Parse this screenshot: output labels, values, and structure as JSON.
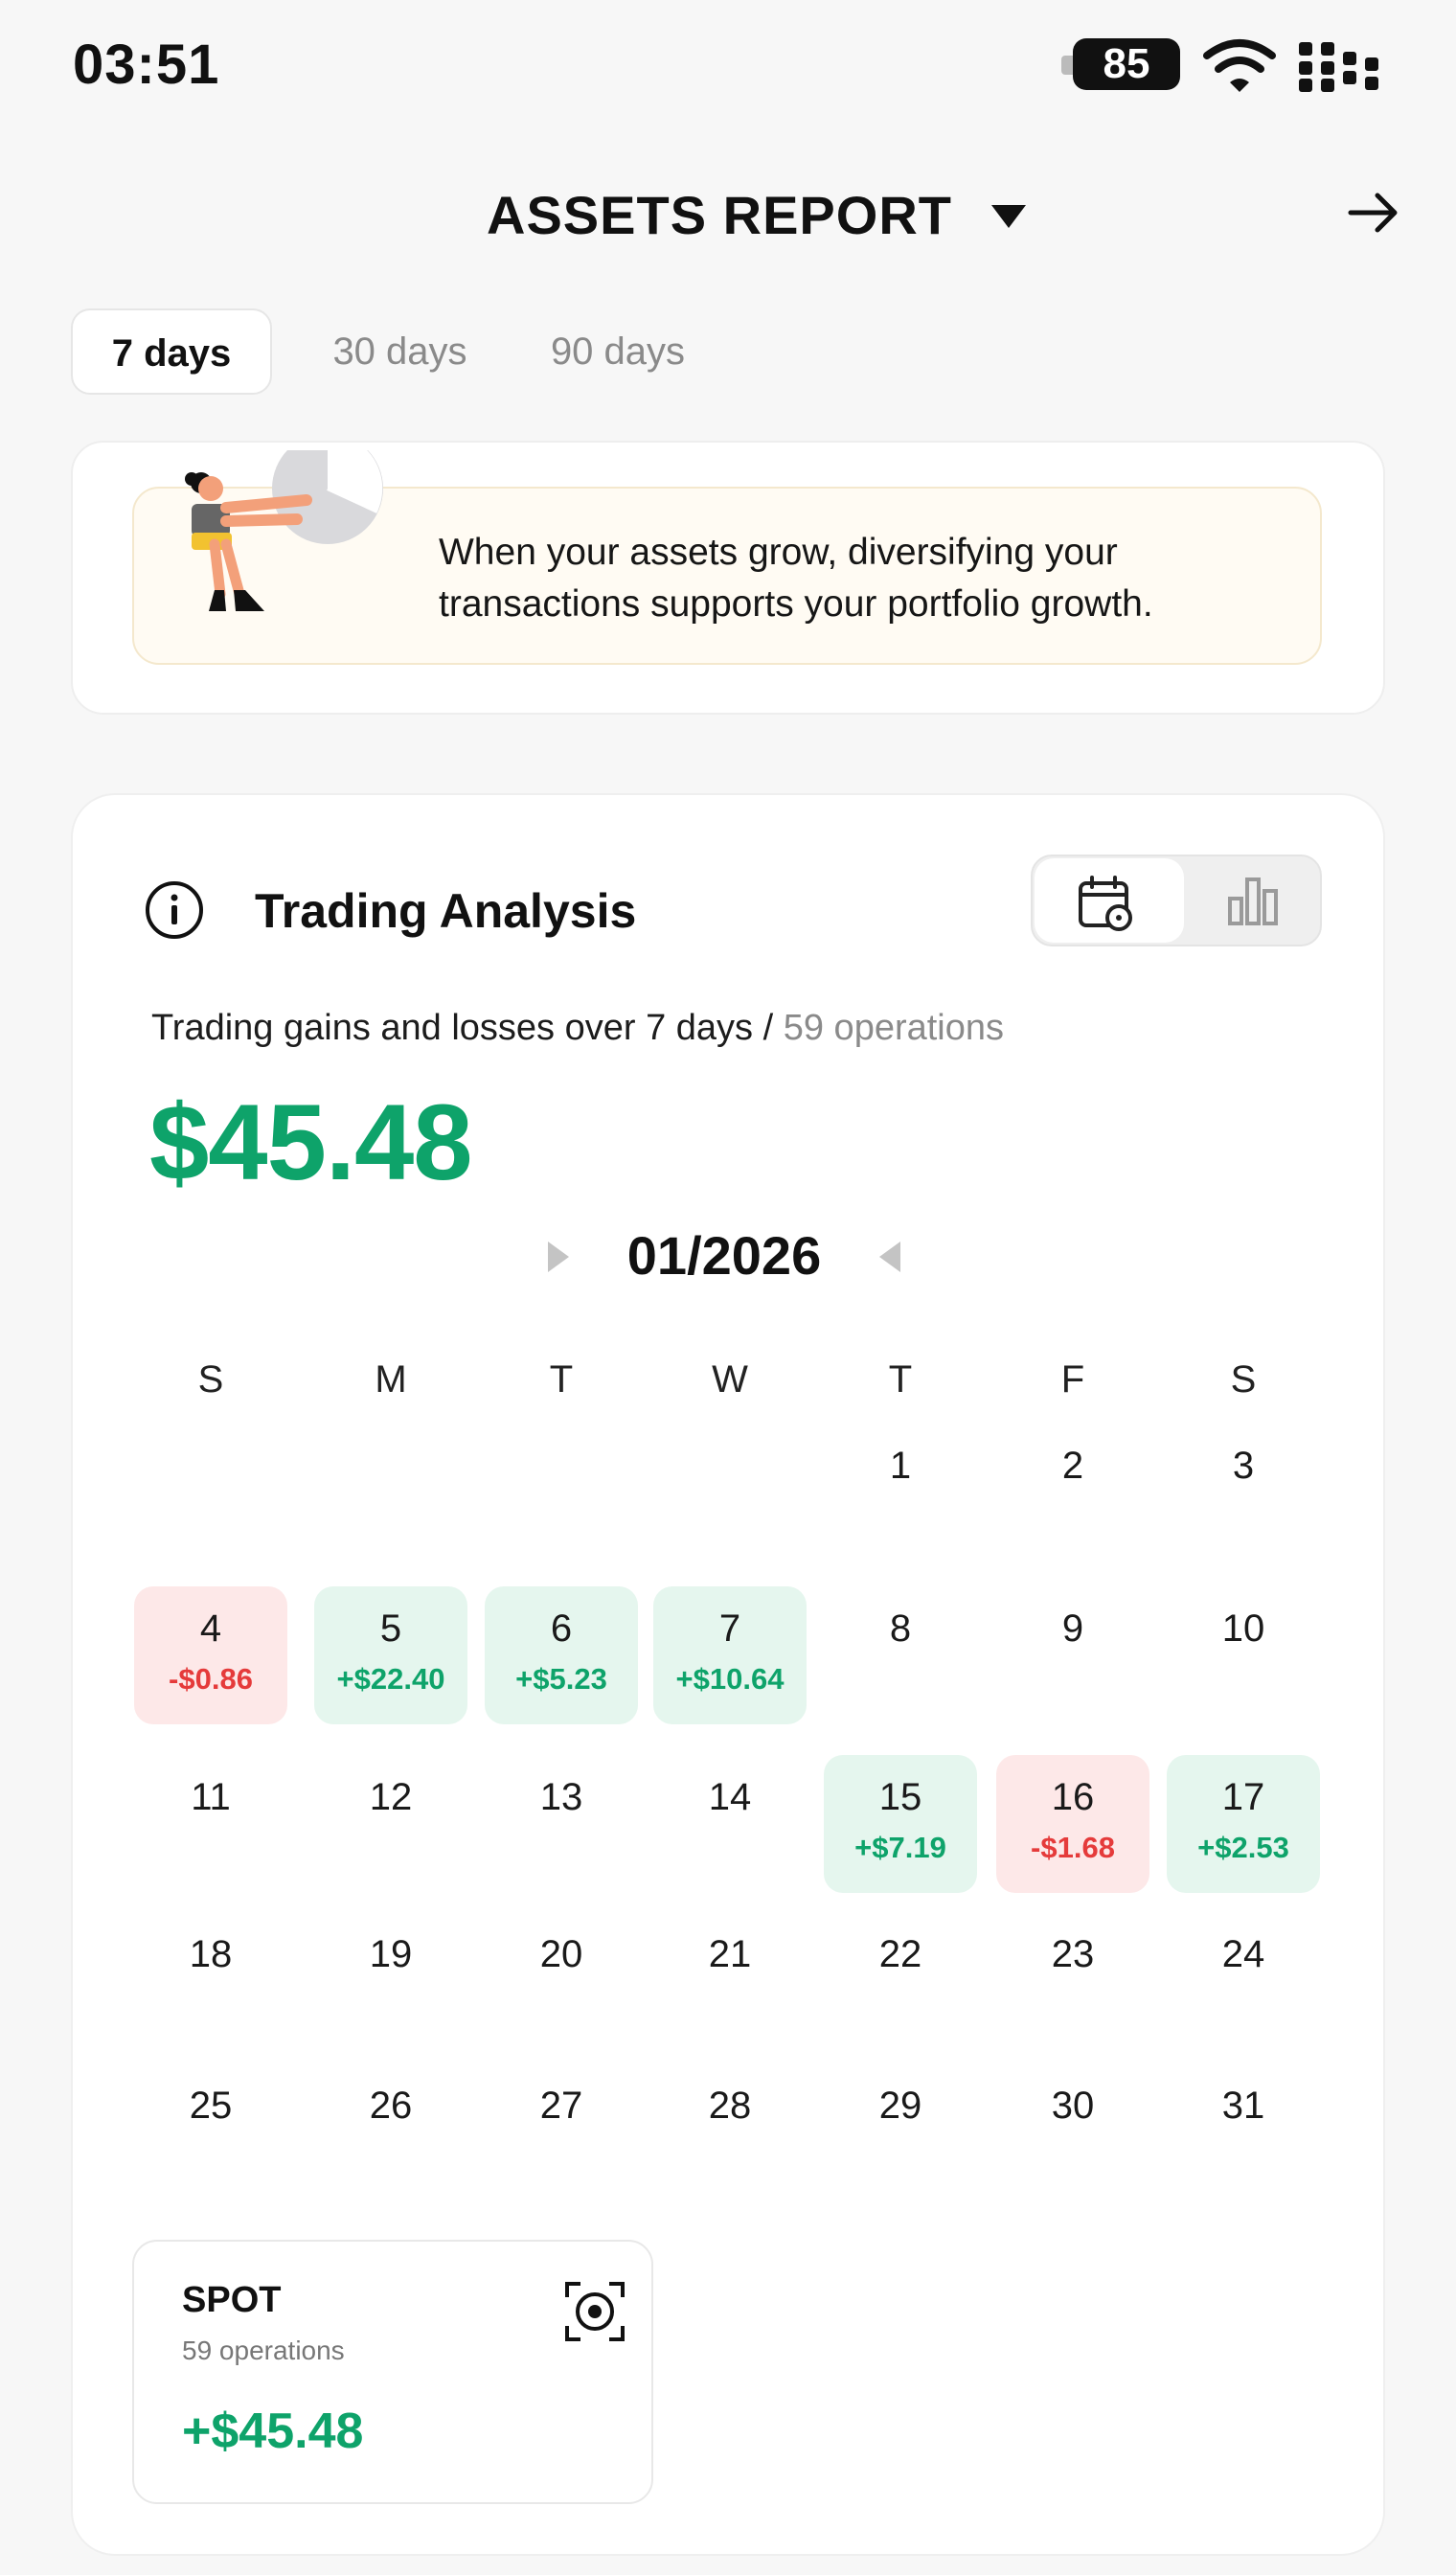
{
  "status_bar": {
    "time": "03:51",
    "battery": "85"
  },
  "header": {
    "title": "ASSETS REPORT"
  },
  "tabs": [
    {
      "label": "7 days",
      "active": true
    },
    {
      "label": "30 days",
      "active": false
    },
    {
      "label": "90 days",
      "active": false
    }
  ],
  "banner": {
    "text": "When your assets grow, diversifying your transactions supports your portfolio growth."
  },
  "trading": {
    "title": "Trading Analysis",
    "subtitle": "Trading gains and losses over 7 days / ",
    "operations": "59 operations",
    "total": "$45.48",
    "month": "01/2026",
    "weekdays": [
      "S",
      "M",
      "T",
      "W",
      "T",
      "F",
      "S"
    ],
    "colors": {
      "gain": "#0ea36a",
      "loss": "#e53b3b"
    },
    "days": [
      {
        "day": "1",
        "pnl": ""
      },
      {
        "day": "2",
        "pnl": ""
      },
      {
        "day": "3",
        "pnl": ""
      },
      {
        "day": "4",
        "pnl": "-$0.86"
      },
      {
        "day": "5",
        "pnl": "+$22.40"
      },
      {
        "day": "6",
        "pnl": "+$5.23"
      },
      {
        "day": "7",
        "pnl": "+$10.64"
      },
      {
        "day": "8",
        "pnl": ""
      },
      {
        "day": "9",
        "pnl": ""
      },
      {
        "day": "10",
        "pnl": ""
      },
      {
        "day": "11",
        "pnl": ""
      },
      {
        "day": "12",
        "pnl": ""
      },
      {
        "day": "13",
        "pnl": ""
      },
      {
        "day": "14",
        "pnl": ""
      },
      {
        "day": "15",
        "pnl": "+$7.19"
      },
      {
        "day": "16",
        "pnl": "-$1.68"
      },
      {
        "day": "17",
        "pnl": "+$2.53"
      },
      {
        "day": "18",
        "pnl": ""
      },
      {
        "day": "19",
        "pnl": ""
      },
      {
        "day": "20",
        "pnl": ""
      },
      {
        "day": "21",
        "pnl": ""
      },
      {
        "day": "22",
        "pnl": ""
      },
      {
        "day": "23",
        "pnl": ""
      },
      {
        "day": "24",
        "pnl": ""
      },
      {
        "day": "25",
        "pnl": ""
      },
      {
        "day": "26",
        "pnl": ""
      },
      {
        "day": "27",
        "pnl": ""
      },
      {
        "day": "28",
        "pnl": ""
      },
      {
        "day": "29",
        "pnl": ""
      },
      {
        "day": "30",
        "pnl": ""
      },
      {
        "day": "31",
        "pnl": ""
      }
    ]
  },
  "spot": {
    "title": "SPOT",
    "operations": "59 operations",
    "value": "+$45.48"
  }
}
